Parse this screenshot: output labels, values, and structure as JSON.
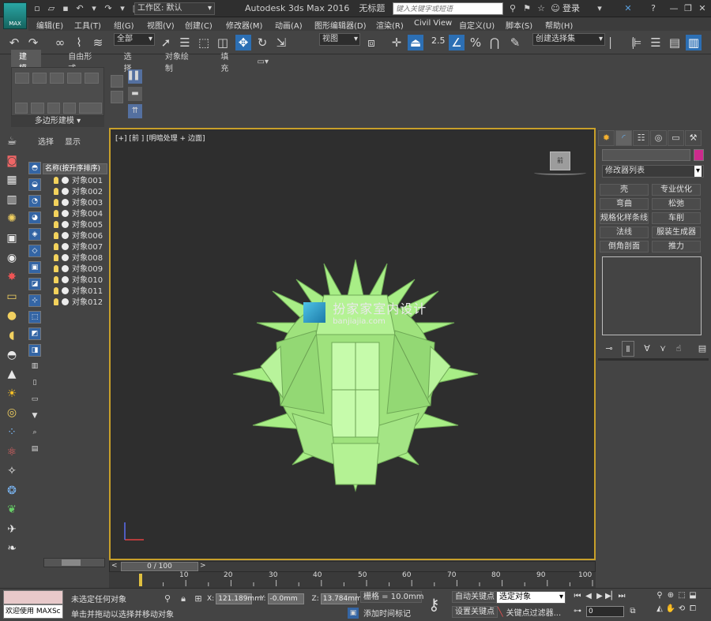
{
  "title_bar": {
    "app_logo": "MAX",
    "workspace_label": "工作区: 默认",
    "window_title": "Autodesk 3ds Max 2016",
    "file_title": "无标题",
    "search_placeholder": "键入关键字或短语",
    "login": "登录"
  },
  "menu": [
    "编辑(E)",
    "工具(T)",
    "组(G)",
    "视图(V)",
    "创建(C)",
    "修改器(M)",
    "动画(A)",
    "图形编辑器(D)",
    "渲染(R)",
    "Civil View",
    "自定义(U)",
    "脚本(S)",
    "帮助(H)"
  ],
  "toolbar": {
    "selection_filter": "全部",
    "reference_coord": "视图",
    "snap_value": "2.5",
    "named_selection": "创建选择集",
    "blue_color": "#2c6fb4"
  },
  "ribbon": {
    "tabs": [
      "建模",
      "自由形式",
      "选择",
      "对象绘制",
      "填充"
    ],
    "footer": "多边形建模"
  },
  "scene_explorer": {
    "tabs": [
      "选择",
      "显示"
    ],
    "header": "名称(按升序排序)",
    "objects": [
      "对象001",
      "对象002",
      "对象003",
      "对象004",
      "对象005",
      "对象006",
      "对象007",
      "对象008",
      "对象009",
      "对象010",
      "对象011",
      "对象012"
    ]
  },
  "viewport": {
    "label": "[+] [前 ] [明暗处理 + 边面]",
    "viewcube_face": "前",
    "watermark_cn": "扮家家室内设计",
    "watermark_url": "banjiajia.com",
    "border_color": "#c8a02a",
    "object_color": "#a8ee86"
  },
  "command_panel": {
    "modifier_list": "修改器列表",
    "modifier_buttons": [
      "壳",
      "专业优化",
      "弯曲",
      "松弛",
      "规格化样条线",
      "车削",
      "法线",
      "服装生成器",
      "倒角剖面",
      "推力"
    ],
    "color_swatch": "#cc2a8d"
  },
  "timeline": {
    "frame_display": "0 / 100",
    "tick_labels": [
      "10",
      "20",
      "30",
      "40",
      "50",
      "60",
      "70",
      "80",
      "90",
      "100"
    ]
  },
  "status_bar": {
    "maxscript_label": "欢迎使用 MAXSc",
    "selection_status": "未选定任何对象",
    "prompt": "单击并拖动以选择并移动对象",
    "x_label": "X:",
    "x_value": "121.189mm",
    "y_label": "Y:",
    "y_value": "-0.0mm",
    "z_label": "Z:",
    "z_value": "13.784mm",
    "grid": "栅格 = 10.0mm",
    "add_time_tag": "添加时间标记",
    "auto_key": "自动关键点",
    "set_key": "设置关键点",
    "key_target": "选定对象",
    "key_filters": "关键点过滤器...",
    "current_frame": "0"
  }
}
